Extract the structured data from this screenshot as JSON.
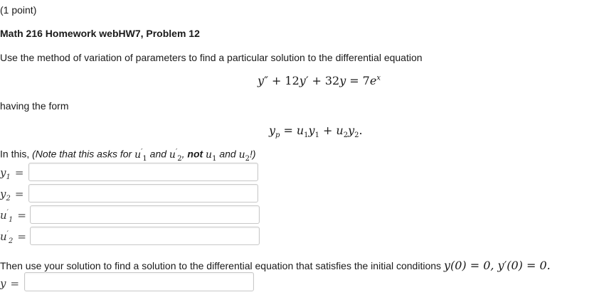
{
  "header": {
    "points": "(1 point)",
    "problem_title": "Math 216 Homework webHW7, Problem 12"
  },
  "problem": {
    "intro": "Use the method of variation of parameters to find a particular solution to the differential equation",
    "equation": {
      "lhs_term1": "y″",
      "plus1": "+",
      "lhs_term2_coef": "12",
      "lhs_term2": "y′",
      "plus2": "+",
      "lhs_term3_coef": "32",
      "lhs_term3": "y",
      "equals": "=",
      "rhs_coef": "7",
      "rhs_base": "e",
      "rhs_exp": "x"
    },
    "having_the_form": "having the form",
    "form": {
      "yp": "y",
      "yp_sub": "p",
      "equals": "=",
      "u1": "u",
      "u1_sub": "1",
      "y1": "y",
      "y1_sub": "1",
      "plus": "+",
      "u2": "u",
      "u2_sub": "2",
      "y2": "y",
      "y2_sub": "2",
      "period": "."
    },
    "note": {
      "in_this": "In this,",
      "open": "(Note that this asks for",
      "u1p": "u",
      "u1p_sup": "′",
      "u1p_sub": "1",
      "and1": "and",
      "u2p": "u",
      "u2p_sup": "′",
      "u2p_sub": "2",
      "comma": ",",
      "not": "not",
      "u1": "u",
      "u1_sub": "1",
      "and2": "and",
      "u2": "u",
      "u2_sub": "2",
      "close": "!)"
    }
  },
  "fields": [
    {
      "var": "y",
      "sub": "1",
      "prime": "",
      "equals": "=",
      "value": "",
      "placeholder": ""
    },
    {
      "var": "y",
      "sub": "2",
      "prime": "",
      "equals": "=",
      "value": "",
      "placeholder": ""
    },
    {
      "var": "u",
      "sub": "1",
      "prime": "′",
      "equals": "=",
      "value": "",
      "placeholder": ""
    },
    {
      "var": "u",
      "sub": "2",
      "prime": "′",
      "equals": "=",
      "value": "",
      "placeholder": ""
    }
  ],
  "ivp": {
    "text": "Then use your solution to find a solution to the differential equation that satisfies the initial conditions",
    "cond": "y(0) = 0, y′(0) = 0.",
    "final_var": "y",
    "final_equals": "=",
    "final_value": "",
    "final_placeholder": ""
  }
}
